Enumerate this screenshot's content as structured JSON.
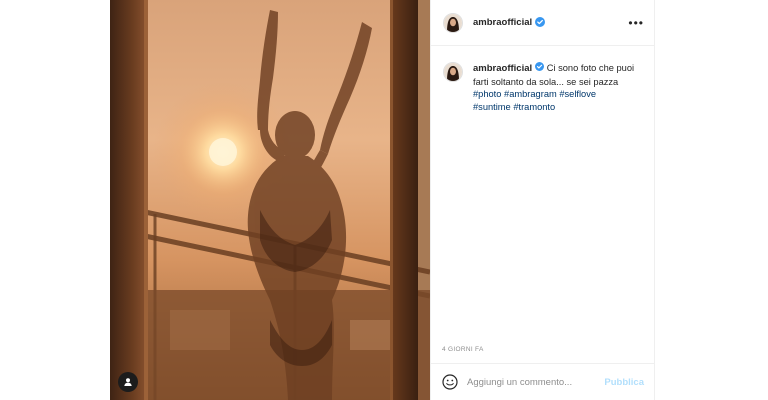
{
  "colors": {
    "link": "#00376b",
    "verified_badge": "#3897f0",
    "publish_disabled": "#b2dffc",
    "muted_text": "#8e8e8e"
  },
  "icons": {
    "verified": "verified-badge-icon",
    "more": "more-options-icon",
    "emoji": "emoji-icon",
    "tagged_user": "user-tag-icon"
  },
  "post": {
    "header": {
      "username": "ambraofficial",
      "more_label": "•••"
    },
    "caption": {
      "username": "ambraofficial",
      "text": "Ci sono foto che puoi farti soltanto da sola... se sei pazza",
      "hashtags": [
        "#photo",
        "#ambragram",
        "#selflove",
        "#suntime",
        "#tramonto"
      ]
    },
    "timestamp": "4 GIORNI FA",
    "comment": {
      "placeholder": "Aggiungi un commento...",
      "value": "",
      "submit_label": "Pubblica"
    }
  }
}
